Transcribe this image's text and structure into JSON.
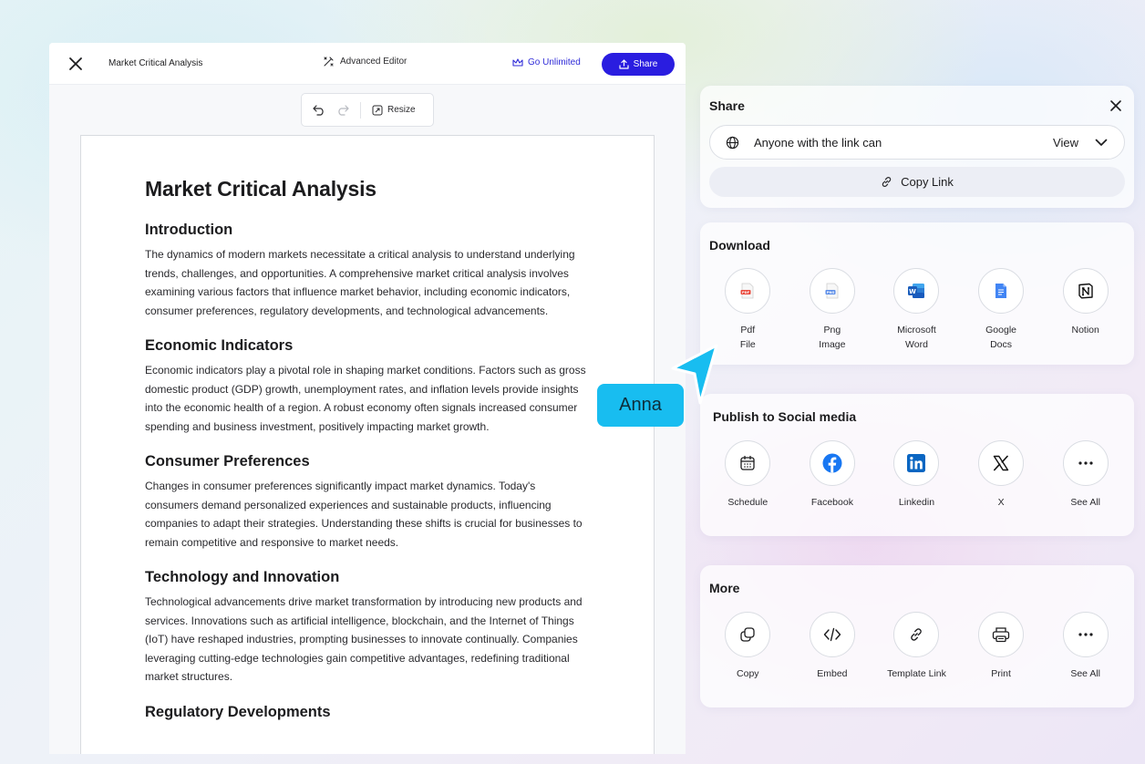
{
  "editor": {
    "doc_title": "Market Critical Analysis",
    "advanced_editor_label": "Advanced Editor",
    "go_unlimited_label": "Go Unlimited",
    "share_label": "Share",
    "resize_label": "Resize"
  },
  "document": {
    "title": "Market Critical Analysis",
    "sections": [
      {
        "heading": "Introduction",
        "body": "The dynamics of modern markets necessitate a critical analysis to understand underlying trends, challenges, and opportunities. A comprehensive market critical analysis involves examining various factors that influence market behavior, including economic indicators, consumer preferences, regulatory developments, and technological advancements."
      },
      {
        "heading": "Economic Indicators",
        "body": "Economic indicators play a pivotal role in shaping market conditions. Factors such as gross domestic product (GDP) growth, unemployment rates, and inflation levels provide insights into the economic health of a region. A robust economy often signals increased consumer spending and business investment, positively impacting market growth."
      },
      {
        "heading": "Consumer Preferences",
        "body": "Changes in consumer preferences significantly impact market dynamics. Today's consumers demand personalized experiences and sustainable products, influencing companies to adapt their strategies. Understanding these shifts is crucial for businesses to remain competitive and responsive to market needs."
      },
      {
        "heading": "Technology and Innovation",
        "body": "Technological advancements drive market transformation by introducing new products and services. Innovations such as artificial intelligence, blockchain, and the Internet of Things (IoT) have reshaped industries, prompting businesses to innovate continually. Companies leveraging cutting-edge technologies gain competitive advantages, redefining traditional market structures."
      },
      {
        "heading": "Regulatory Developments",
        "body": ""
      }
    ]
  },
  "share": {
    "title": "Share",
    "link_access_text": "Anyone with the link can",
    "permission": "View",
    "copy_link_label": "Copy Link"
  },
  "download": {
    "title": "Download",
    "items": [
      {
        "label": "Pdf\nFile",
        "icon": "pdf-icon"
      },
      {
        "label": "Png\nImage",
        "icon": "png-icon"
      },
      {
        "label": "Microsoft\nWord",
        "icon": "word-icon"
      },
      {
        "label": "Google\nDocs",
        "icon": "google-docs-icon"
      },
      {
        "label": "Notion",
        "icon": "notion-icon"
      }
    ]
  },
  "social": {
    "title": "Publish to Social media",
    "items": [
      {
        "label": "Schedule",
        "icon": "calendar-icon"
      },
      {
        "label": "Facebook",
        "icon": "facebook-icon"
      },
      {
        "label": "Linkedin",
        "icon": "linkedin-icon"
      },
      {
        "label": "X",
        "icon": "x-icon"
      },
      {
        "label": "See All",
        "icon": "more-icon"
      }
    ]
  },
  "more": {
    "title": "More",
    "items": [
      {
        "label": "Copy",
        "icon": "copy-icon"
      },
      {
        "label": "Embed",
        "icon": "code-icon"
      },
      {
        "label": "Template Link",
        "icon": "link-icon"
      },
      {
        "label": "Print",
        "icon": "printer-icon"
      },
      {
        "label": "See All",
        "icon": "more-icon"
      }
    ]
  },
  "collaborator": {
    "name": "Anna"
  },
  "colors": {
    "accent": "#2a1de0",
    "collaborator": "#18bdf0"
  }
}
